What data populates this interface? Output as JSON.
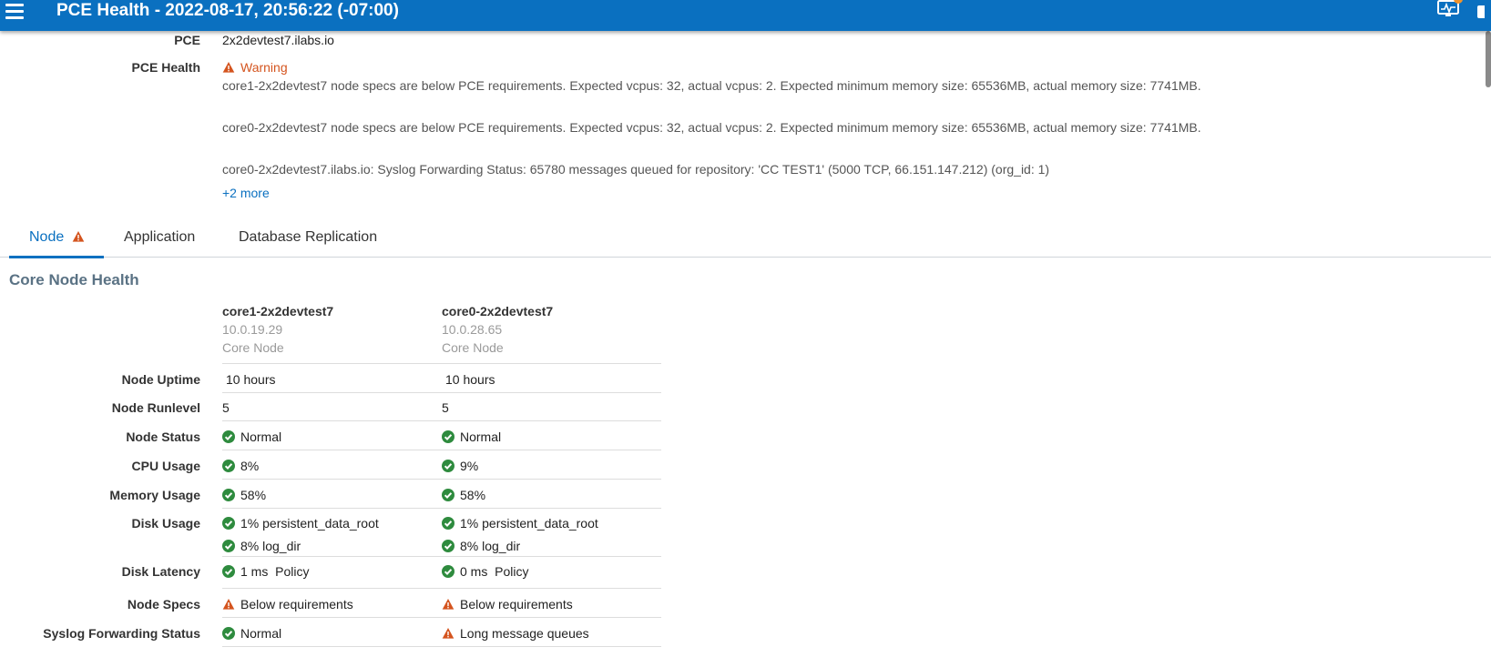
{
  "header": {
    "title": "PCE Health - 2022-08-17, 20:56:22 (-07:00)"
  },
  "summary": {
    "pce_label": "PCE",
    "pce_value": "2x2devtest7.ilabs.io",
    "health_label": "PCE Health",
    "health_status": "Warning",
    "messages": [
      "core1-2x2devtest7 node specs are below PCE requirements. Expected vcpus: 32, actual vcpus: 2. Expected minimum memory size: 65536MB, actual memory size: 7741MB.",
      "core0-2x2devtest7 node specs are below PCE requirements. Expected vcpus: 32, actual vcpus: 2. Expected minimum memory size: 65536MB, actual memory size: 7741MB.",
      "core0-2x2devtest7.ilabs.io: Syslog Forwarding Status: 65780 messages queued for repository: 'CC TEST1' (5000 TCP, 66.151.147.212) (org_id: 1)"
    ],
    "more_link": "+2 more"
  },
  "tabs": [
    {
      "label": "Node",
      "active": true,
      "warning": true
    },
    {
      "label": "Application",
      "active": false
    },
    {
      "label": "Database Replication",
      "active": false
    }
  ],
  "section_title": "Core Node Health",
  "nodes": [
    {
      "name": "core1-2x2devtest7",
      "ip": "10.0.19.29",
      "type": "Core Node"
    },
    {
      "name": "core0-2x2devtest7",
      "ip": "10.0.28.65",
      "type": "Core Node"
    }
  ],
  "rows": {
    "uptime": {
      "label": "Node Uptime",
      "values": [
        "10 hours",
        "10 hours"
      ]
    },
    "runlevel": {
      "label": "Node Runlevel",
      "values": [
        "5",
        "5"
      ]
    },
    "status": {
      "label": "Node Status",
      "values": [
        "Normal",
        "Normal"
      ]
    },
    "cpu": {
      "label": "CPU Usage",
      "values": [
        "8%",
        "9%"
      ]
    },
    "memory": {
      "label": "Memory Usage",
      "values": [
        "58%",
        "58%"
      ]
    },
    "disk": {
      "label": "Disk Usage",
      "values": [
        "1% persistent_data_root",
        "1% persistent_data_root"
      ],
      "values2": [
        "8% log_dir",
        "8% log_dir"
      ]
    },
    "latency": {
      "label": "Disk Latency",
      "values": [
        "1 ms  Policy",
        "0 ms  Policy"
      ]
    },
    "specs": {
      "label": "Node Specs",
      "values": [
        "Below requirements",
        "Below requirements"
      ]
    },
    "syslog": {
      "label": "Syslog Forwarding Status",
      "values": [
        "Normal",
        "Long message queues"
      ]
    }
  },
  "colors": {
    "header": "#0a70c0",
    "ok": "#2e8b3e",
    "warning": "#d4541e"
  }
}
